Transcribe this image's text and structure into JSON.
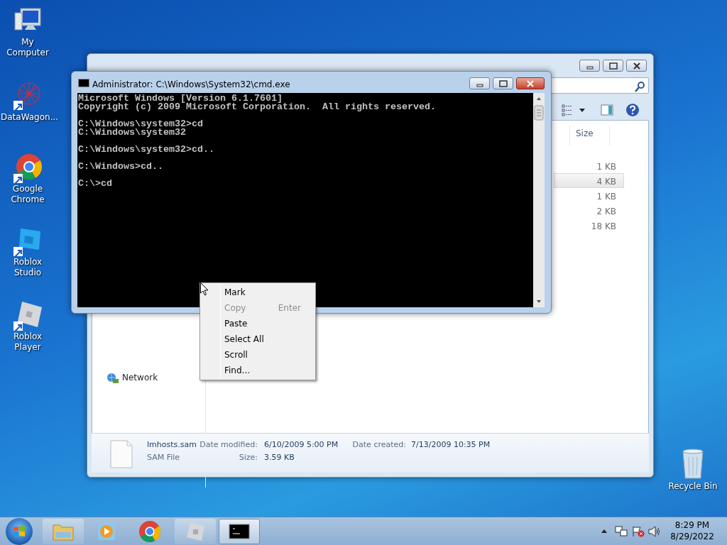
{
  "desktop_icons": [
    {
      "kind": "computer",
      "label": "My Computer"
    },
    {
      "kind": "network-art",
      "label": "DataWagon..."
    },
    {
      "kind": "chrome",
      "label": "Google Chrome"
    },
    {
      "kind": "studio",
      "label": "Roblox Studio"
    },
    {
      "kind": "player",
      "label": "Roblox Player"
    }
  ],
  "recycle_bin": {
    "label": "Recycle Bin"
  },
  "explorer": {
    "column": "Size",
    "rows": [
      {
        "size": "1 KB",
        "selected": false
      },
      {
        "size": "4 KB",
        "selected": true
      },
      {
        "size": "1 KB",
        "selected": false
      },
      {
        "size": "2 KB",
        "selected": false
      },
      {
        "size": "18 KB",
        "selected": false
      }
    ],
    "nav_item": "Network",
    "details": {
      "name": "lmhosts.sam",
      "type": "SAM File",
      "modified_label": "Date modified:",
      "modified": "6/10/2009 5:00 PM",
      "created_label": "Date created:",
      "created": "7/13/2009 10:35 PM",
      "size_label": "Size:",
      "size": "3.59 KB"
    }
  },
  "cmd": {
    "title": "Administrator: C:\\Windows\\System32\\cmd.exe",
    "blocks": [
      [
        "Microsoft Windows [Version 6.1.7601]",
        "Copyright (c) 2009 Microsoft Corporation.  All rights reserved."
      ],
      [
        "C:\\Windows\\system32>cd",
        "C:\\Windows\\system32"
      ],
      [
        "C:\\Windows\\system32>cd.."
      ],
      [
        "C:\\Windows>cd.."
      ],
      [
        "C:\\>cd"
      ]
    ]
  },
  "context_menu": [
    {
      "label": "Mark",
      "disabled": false
    },
    {
      "label": "Copy",
      "shortcut": "Enter",
      "disabled": true
    },
    {
      "label": "Paste",
      "disabled": false
    },
    {
      "label": "Select All",
      "disabled": false
    },
    {
      "label": "Scroll",
      "disabled": false
    },
    {
      "label": "Find...",
      "disabled": false
    }
  ],
  "taskbar": [
    {
      "kind": "explorer",
      "active": false
    },
    {
      "kind": "media",
      "active": false
    },
    {
      "kind": "chrome",
      "active": false
    },
    {
      "kind": "player",
      "active": false
    },
    {
      "kind": "console",
      "active": true
    }
  ],
  "clock": {
    "time": "8:29 PM",
    "date": "8/29/2022"
  }
}
